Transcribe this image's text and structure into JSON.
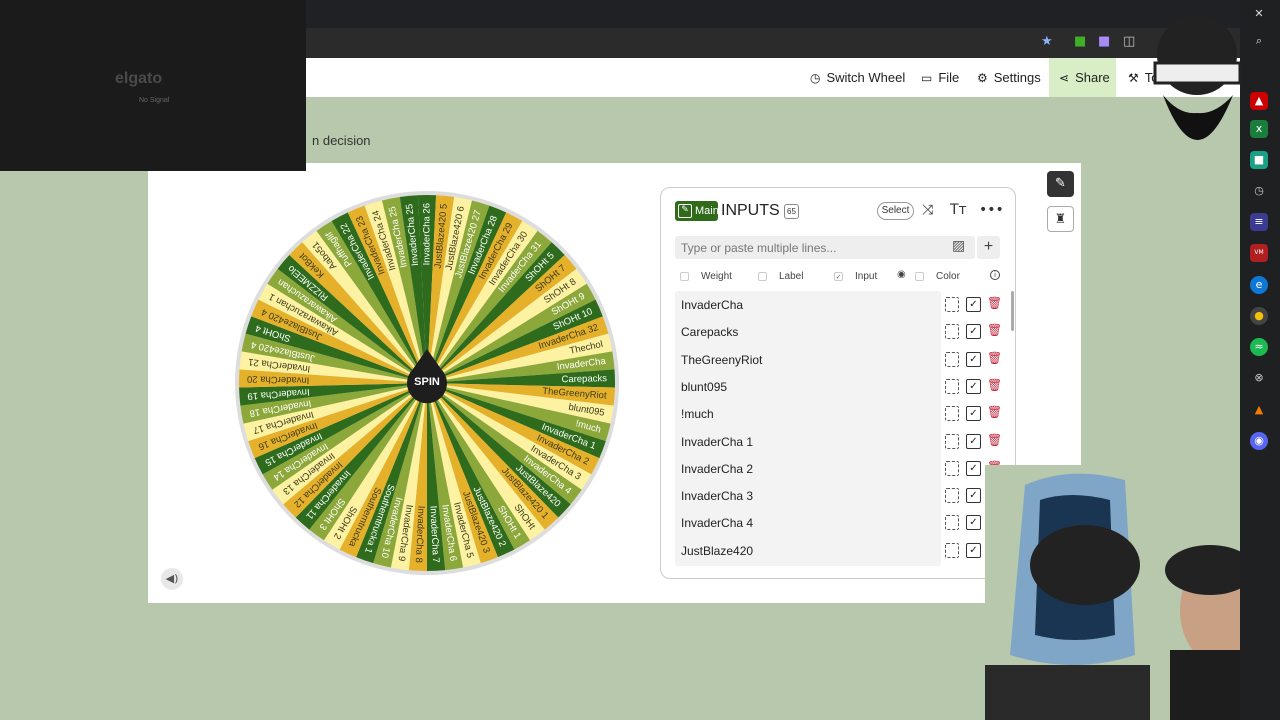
{
  "browser": {
    "icons": [
      "star-icon",
      "extension-icon",
      "profile-icon",
      "puzzle-icon",
      "menu-icon"
    ]
  },
  "header": {
    "switch_wheel": "Switch Wheel",
    "file": "File",
    "settings": "Settings",
    "share": "Share",
    "tools": "Tools"
  },
  "page": {
    "subtitle_fragment": "n decision"
  },
  "wheel": {
    "spin_label": "SPIN",
    "colors": [
      "#2e6b1c",
      "#e6b12a",
      "#fdf2a2",
      "#8da83a"
    ],
    "segments": [
      "InvaderCha 26",
      "JustBlaze420 5",
      "JustBlaze420 6",
      "JustBlaze420 27",
      "InvaderCha 28",
      "InvaderCha 29",
      "InvaderCha 30",
      "InvaderCha 31",
      "ShOHt 5",
      "ShOHt 7",
      "ShOHt 8",
      "ShOHt 9",
      "ShOHt 10",
      "InvaderCha 32",
      "Thechol",
      "InvaderCha",
      "Carepacks",
      "TheGreenyRiot",
      "blunt095",
      "!much",
      "InvaderCha 1",
      "InvaderCha 2",
      "InvaderCha 3",
      "InvaderCha 4",
      "JustBlaze420",
      "JustBlaze420 1",
      "ShOHt",
      "ShOHt 1",
      "JustBlaze420 2",
      "JustBlaze420 3",
      "InvaderCha 5",
      "InvaderCha 6",
      "InvaderCha 7",
      "InvaderCha 8",
      "InvaderCha 9",
      "InvaderCha 10",
      "Southerntrucka 1",
      "Southerntrucka",
      "ShOHt 2",
      "ShOHt 3",
      "InvaderCha 11",
      "InvaderCha 12",
      "InvaderCha 13",
      "InvaderCha 14",
      "InvaderCha 15",
      "InvaderCha 16",
      "InvaderCha 17",
      "InvaderCha 18",
      "InvaderCha 19",
      "InvaderCha 20",
      "InvaderCha 21",
      "JustBlaze420 4",
      "ShOHt 4",
      "JustBlaze420 4",
      "Aikawarazuchan 1",
      "Aikawarazuchan",
      "RIZZMEElo",
      "KekBot",
      "Aabo51",
      "Puffhaglif",
      "InvaderCha 22",
      "InvaderCha 23",
      "InvaderCha 24",
      "InvaderCha 25",
      "InvaderCha 25"
    ]
  },
  "inputs": {
    "badge": "Main",
    "title": "INPUTS",
    "count": "65",
    "select_label": "Select",
    "placeholder": "Type or paste multiple lines...",
    "options": {
      "weight": "Weight",
      "label": "Label",
      "input": "Input",
      "color": "Color"
    },
    "entries": [
      "InvaderCha",
      "Carepacks",
      "TheGreenyRiot",
      "blunt095",
      "!much",
      "InvaderCha 1",
      "InvaderCha 2",
      "InvaderCha 3",
      "InvaderCha 4",
      "JustBlaze420"
    ]
  },
  "stream_overlay": {
    "elgato_logo": "elgato",
    "no_signal": "No Signal"
  }
}
